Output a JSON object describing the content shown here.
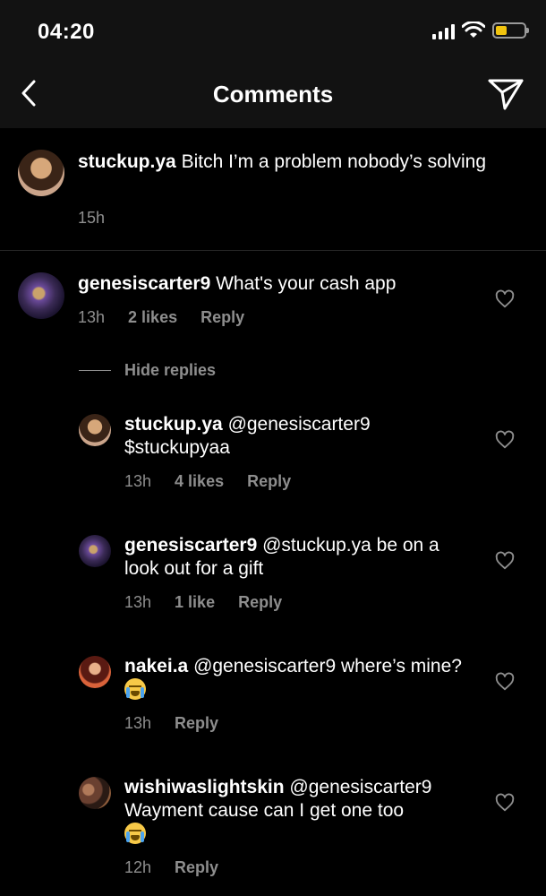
{
  "status_bar": {
    "time": "04:20"
  },
  "header": {
    "title": "Comments",
    "back_icon": "chevron-left-icon",
    "send_icon": "paper-plane-icon"
  },
  "caption": {
    "username": "stuckup.ya",
    "text": "Bitch I’m a problem nobody’s solving",
    "time": "15h"
  },
  "comment": {
    "username": "genesiscarter9",
    "text": "What's your cash app",
    "time": "13h",
    "likes": "2 likes",
    "reply": "Reply",
    "hide_replies": "Hide replies"
  },
  "replies": [
    {
      "username": "stuckup.ya",
      "text": "@genesiscarter9 $stuckupyaa",
      "time": "13h",
      "likes": "4 likes",
      "reply": "Reply"
    },
    {
      "username": "genesiscarter9",
      "text": "@stuckup.ya be on a look out for a gift",
      "time": "13h",
      "likes": "1 like",
      "reply": "Reply"
    },
    {
      "username": "nakei.a",
      "text": "@genesiscarter9 where’s mine?",
      "emoji": "loudly-crying-face-emoji",
      "time": "13h",
      "reply": "Reply"
    },
    {
      "username": "wishiwaslightskin",
      "text": "@genesiscarter9 Wayment cause can I get one too",
      "emoji": "loudly-crying-face-emoji",
      "time": "12h",
      "reply": "Reply"
    }
  ],
  "colors": {
    "background": "#000000",
    "header_bg": "#121212",
    "secondary_text": "#8e8e8e",
    "battery": "#f1c40f"
  }
}
